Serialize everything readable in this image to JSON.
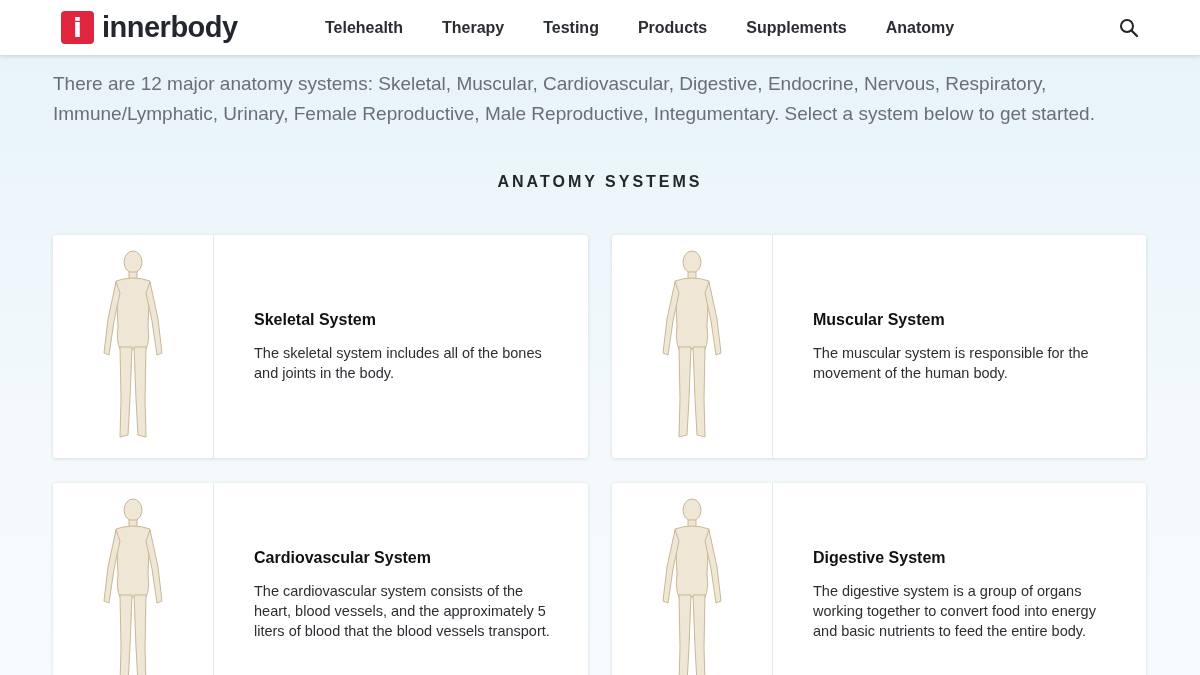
{
  "header": {
    "logo_mark": "i",
    "logo_text": "innerbody",
    "nav": [
      "Telehealth",
      "Therapy",
      "Testing",
      "Products",
      "Supplements",
      "Anatomy"
    ]
  },
  "intro": "There are 12 major anatomy systems: Skeletal, Muscular, Cardiovascular, Digestive, Endocrine, Nervous, Respiratory, Immune/Lymphatic, Urinary, Female Reproductive, Male Reproductive, Integumentary. Select a system below to get started.",
  "section_title": "ANATOMY SYSTEMS",
  "systems": [
    {
      "title": "Skeletal System",
      "description": "The skeletal system includes all of the bones and joints in the body."
    },
    {
      "title": "Muscular System",
      "description": "The muscular system is responsible for the movement of the human body."
    },
    {
      "title": "Cardiovascular System",
      "description": "The cardiovascular system consists of the heart, blood vessels, and the approximately 5 liters of blood that the blood vessels transport."
    },
    {
      "title": "Digestive System",
      "description": "The digestive system is a group of organs working together to convert food into energy and basic nutrients to feed the entire body."
    }
  ]
}
